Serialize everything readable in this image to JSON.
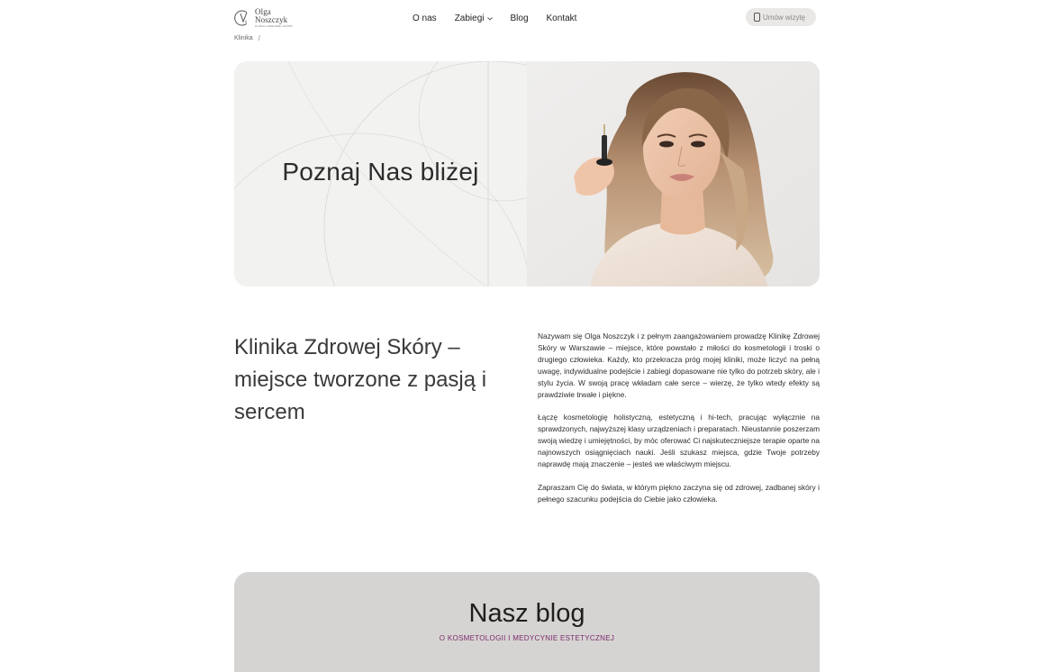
{
  "header": {
    "logo": {
      "name_line1": "Olga",
      "name_line2": "Noszczyk",
      "tagline": "KLINIKA ZDROWEJ SKÓRY",
      "icon": "logo-monogram-icon"
    },
    "nav": [
      {
        "label": "O nas"
      },
      {
        "label": "Zabiegi",
        "icon": "chevron-down-icon"
      },
      {
        "label": "Blog"
      },
      {
        "label": "Kontakt"
      }
    ],
    "cta": {
      "label": "Umów wizytę",
      "icon": "phone-icon"
    }
  },
  "breadcrumb": {
    "items": [
      "Klinika"
    ],
    "separator": "/"
  },
  "hero": {
    "title": "Poznaj Nas bliżej",
    "photo": "portrait-photo"
  },
  "intro": {
    "heading": "Klinika Zdrowej Skóry – miejsce tworzone z pasją i sercem",
    "paragraphs": [
      "Nazywam się Olga Noszczyk i z pełnym zaangażowaniem prowadzę Klinikę Zdrowej Skóry w Warszawie – miejsce, które powstało z miłości do kosmetologii i troski o drugiego człowieka. Każdy, kto przekracza próg mojej kliniki, może liczyć na pełną uwagę, indywidualne podejście i zabiegi dopasowane nie tylko do potrzeb skóry, ale i stylu życia. W swoją pracę wkładam całe serce – wierzę, że tylko wtedy efekty są prawdziwie trwałe i piękne.",
      "Łączę kosmetologię holistyczną, estetyczną i hi-tech, pracując wyłącznie na sprawdzonych, najwyższej klasy urządzeniach i preparatach. Nieustannie poszerzam swoją wiedzę i umiejętności, by móc oferować Ci najskuteczniejsze terapie oparte na najnowszych osiągnięciach nauki. Jeśli szukasz miejsca, gdzie Twoje potrzeby naprawdę mają znaczenie – jesteś we właściwym miejscu.",
      "Zapraszam Cię do świata, w którym piękno zaczyna się od zdrowej, zadbanej skóry i pełnego szacunku podejścia do Ciebie jako człowieka."
    ]
  },
  "blog": {
    "title": "Nasz blog",
    "subtitle": "O KOSMETOLOGII I MEDYCYNIE ESTETYCZNEJ"
  },
  "colors": {
    "accent": "#7a2a6e",
    "blog_bg": "#d6d4d2",
    "cta_bg": "#e9e8e6",
    "hero_bg": "#f2f2f1"
  }
}
